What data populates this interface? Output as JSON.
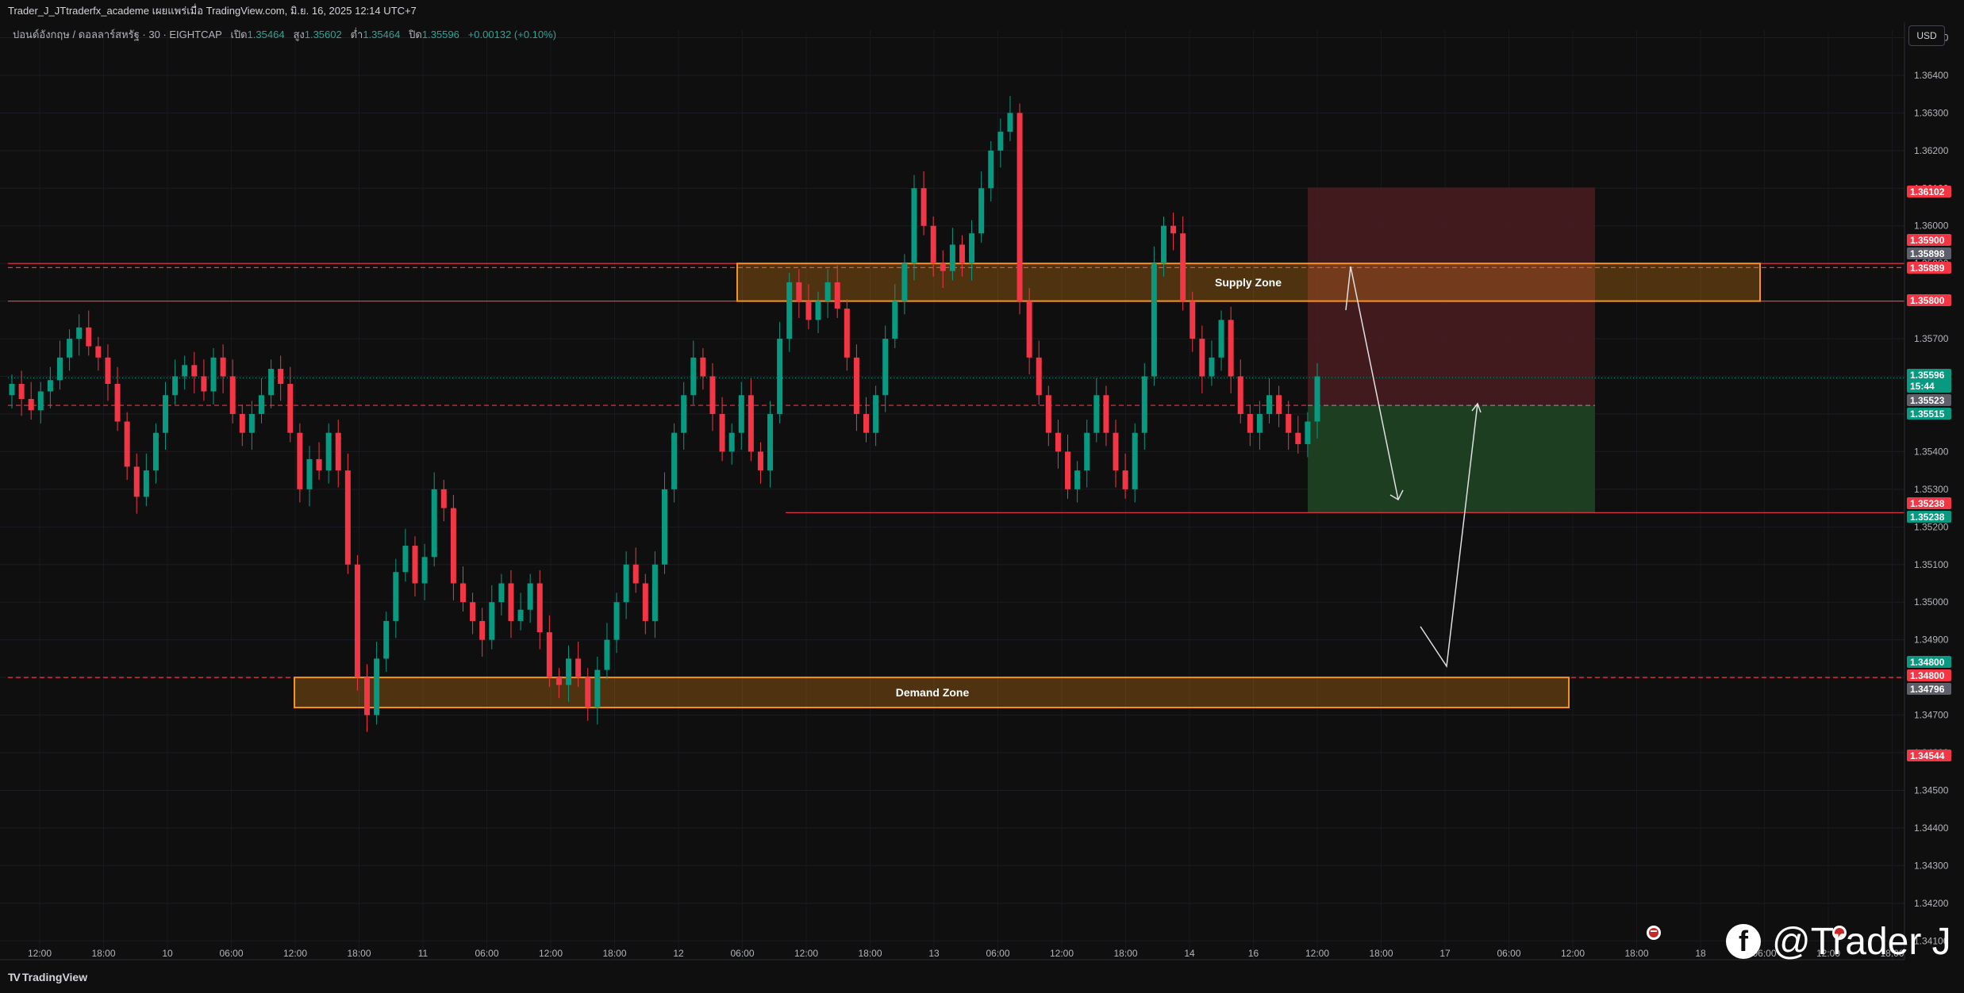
{
  "header": {
    "title": "Trader_J_JTtraderfx_academe เผยแพร่เมื่อ TradingView.com, มิ.ย. 16, 2025 12:14 UTC+7",
    "symbol": "ปอนด์อังกฤษ / ดอลลาร์สหรัฐ · 30 · EIGHTCAP",
    "open_label": "เปิด",
    "open_value": "1.35464",
    "high_label": "สูง",
    "high_value": "1.35602",
    "low_label": "ต่ำ",
    "low_value": "1.35464",
    "close_label": "ปิด",
    "close_value": "1.35596",
    "change": "+0.00132 (+0.10%)"
  },
  "currency_button": "USD",
  "footer": {
    "brand": "TradingView",
    "brand_mark": "TV"
  },
  "watermark": {
    "icon": "facebook-icon",
    "glyph": "f",
    "handle": "@Trader J"
  },
  "colors": {
    "background": "#0f0f0f",
    "up": "#089981",
    "down": "#f23645",
    "zone": "#f7931a",
    "stop_zone": "#5c1f24",
    "target_zone": "#1d4a25",
    "price_tag": "#089981",
    "arrow": "#e0e0e0"
  },
  "chart_data": {
    "type": "candlestick",
    "symbol": "GBPUSD",
    "timeframe": "30",
    "ylim": [
      1.3405,
      1.3652
    ],
    "y_ticks": [
      "1.34100",
      "1.34200",
      "1.34300",
      "1.34400",
      "1.34500",
      "1.34600",
      "1.34700",
      "1.34800",
      "1.34900",
      "1.35000",
      "1.35100",
      "1.35200",
      "1.35300",
      "1.35400",
      "1.35500",
      "1.35600",
      "1.35700",
      "1.35800",
      "1.35900",
      "1.36000",
      "1.36100",
      "1.36200",
      "1.36300",
      "1.36400",
      "1.36500"
    ],
    "x_ticks": [
      "12:00",
      "18:00",
      "10",
      "06:00",
      "12:00",
      "18:00",
      "11",
      "06:00",
      "12:00",
      "18:00",
      "12",
      "06:00",
      "12:00",
      "18:00",
      "13",
      "06:00",
      "12:00",
      "18:00",
      "14",
      "16",
      "12:00",
      "18:00",
      "17",
      "06:00",
      "12:00",
      "18:00",
      "18",
      "06:00",
      "12:00",
      "18:00"
    ],
    "candles_closes": [
      1.3558,
      1.3554,
      1.3551,
      1.3556,
      1.3559,
      1.3565,
      1.357,
      1.3573,
      1.3568,
      1.3565,
      1.3558,
      1.3548,
      1.3536,
      1.3528,
      1.3535,
      1.3545,
      1.3555,
      1.356,
      1.3563,
      1.356,
      1.3556,
      1.3565,
      1.356,
      1.355,
      1.3545,
      1.355,
      1.3555,
      1.3562,
      1.3558,
      1.3545,
      1.353,
      1.3538,
      1.3535,
      1.3545,
      1.3535,
      1.351,
      1.348,
      1.347,
      1.3485,
      1.3495,
      1.3508,
      1.3515,
      1.3505,
      1.3512,
      1.353,
      1.3525,
      1.3505,
      1.35,
      1.3495,
      1.349,
      1.35,
      1.3505,
      1.3495,
      1.3498,
      1.3505,
      1.3492,
      1.348,
      1.3478,
      1.3485,
      1.348,
      1.3472,
      1.3482,
      1.349,
      1.35,
      1.351,
      1.3505,
      1.3495,
      1.351,
      1.353,
      1.3545,
      1.3555,
      1.3565,
      1.356,
      1.355,
      1.354,
      1.3545,
      1.3555,
      1.354,
      1.3535,
      1.355,
      1.357,
      1.3585,
      1.358,
      1.3575,
      1.358,
      1.3585,
      1.3578,
      1.3565,
      1.355,
      1.3545,
      1.3555,
      1.357,
      1.358,
      1.359,
      1.361,
      1.36,
      1.359,
      1.3588,
      1.3595,
      1.359,
      1.3598,
      1.361,
      1.362,
      1.3625,
      1.363,
      1.358,
      1.3565,
      1.3555,
      1.3545,
      1.354,
      1.353,
      1.3535,
      1.3545,
      1.3555,
      1.3545,
      1.3535,
      1.353,
      1.3545,
      1.356,
      1.359,
      1.36,
      1.3598,
      1.358,
      1.357,
      1.356,
      1.3565,
      1.3575,
      1.356,
      1.355,
      1.3545,
      1.355,
      1.3555,
      1.355,
      1.3545,
      1.3542,
      1.3548,
      1.356
    ],
    "price_labels": [
      {
        "value": "1.36102",
        "color": "red"
      },
      {
        "value": "1.35900",
        "color": "red"
      },
      {
        "value": "1.35898",
        "color": "gray"
      },
      {
        "value": "1.35889",
        "color": "red"
      },
      {
        "value": "1.35800",
        "color": "red"
      },
      {
        "value": "1.35596",
        "color": "green",
        "sub": "15:44"
      },
      {
        "value": "1.35523",
        "color": "gray"
      },
      {
        "value": "1.35515",
        "color": "green"
      },
      {
        "value": "1.35238",
        "color": "red"
      },
      {
        "value": "1.35238",
        "color": "green"
      },
      {
        "value": "1.34800",
        "color": "green"
      },
      {
        "value": "1.34800",
        "color": "red"
      },
      {
        "value": "1.34796",
        "color": "gray"
      },
      {
        "value": "1.34544",
        "color": "red"
      }
    ],
    "zones": [
      {
        "label": "Supply Zone",
        "low": 1.358,
        "high": 1.359
      },
      {
        "label": "Demand Zone",
        "low": 1.3472,
        "high": 1.348
      }
    ],
    "horizontal_lines": [
      1.35889,
      1.358,
      1.35238,
      1.348,
      1.35523
    ],
    "positions": [
      {
        "type": "short",
        "entry": 1.35523,
        "stop": 1.36102,
        "target": 1.35238
      },
      {
        "type": "long",
        "entry": 1.35523,
        "stop": 1.34544,
        "target": 1.348
      }
    ]
  }
}
